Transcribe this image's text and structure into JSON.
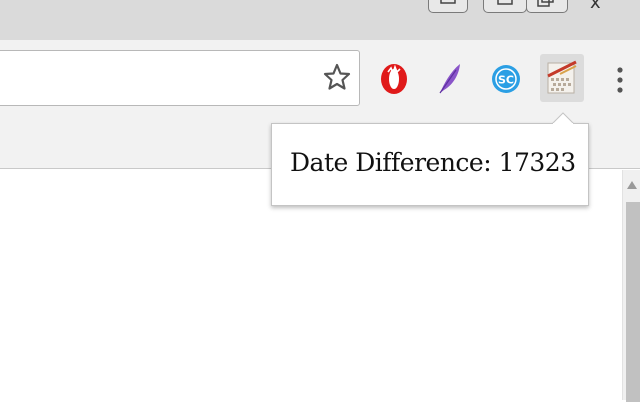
{
  "window_controls": {
    "items": [
      "minimize",
      "maximize",
      "restore",
      "close"
    ],
    "close_glyph": "x"
  },
  "toolbar": {
    "bookmark_icon": "star-outline-icon",
    "extensions": [
      {
        "name": "opera",
        "icon": "opera-o-icon",
        "color": "#e01a1a"
      },
      {
        "name": "quill",
        "icon": "purple-feather-icon",
        "color": "#8a55c9"
      },
      {
        "name": "sc",
        "icon": "sc-circle-icon",
        "color": "#2b9fe4"
      },
      {
        "name": "date-difference",
        "icon": "date-difference-icon",
        "active": true
      }
    ],
    "menu_icon": "three-dot-menu-icon"
  },
  "popup": {
    "text": "Date Difference: 17323"
  },
  "colors": {
    "titlebar": "#dadada",
    "toolbar": "#f2f2f2",
    "content": "#ffffff",
    "scroll_thumb": "#c1c1c1"
  }
}
